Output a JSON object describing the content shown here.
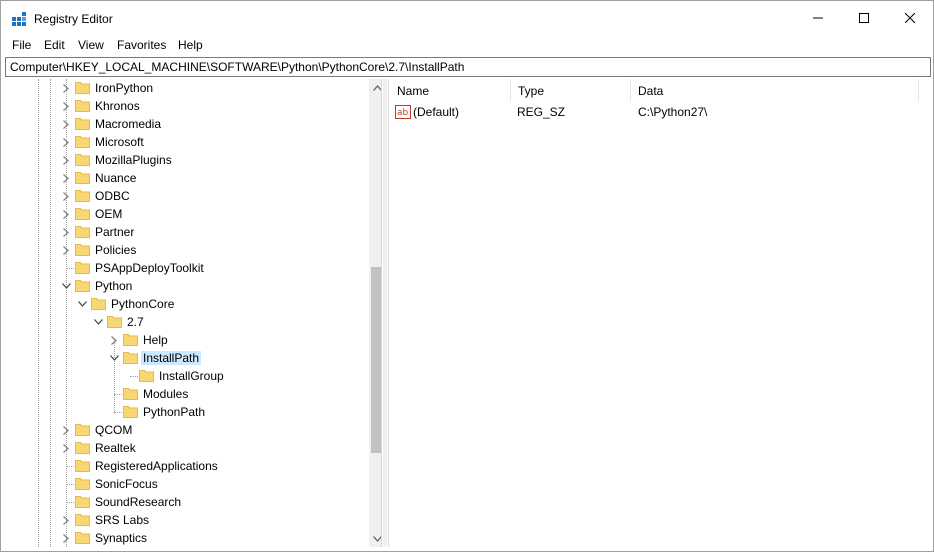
{
  "window": {
    "title": "Registry Editor",
    "icon": "registry-editor-icon",
    "controls": {
      "minimize": "minimize-icon",
      "maximize": "maximize-icon",
      "close": "close-icon"
    }
  },
  "menu": {
    "items": [
      "File",
      "Edit",
      "View",
      "Favorites",
      "Help"
    ]
  },
  "address": {
    "path": "Computer\\HKEY_LOCAL_MACHINE\\SOFTWARE\\Python\\PythonCore\\2.7\\InstallPath"
  },
  "tree": {
    "items": [
      {
        "label": "IronPython",
        "expander": "collapsed"
      },
      {
        "label": "Khronos",
        "expander": "collapsed"
      },
      {
        "label": "Macromedia",
        "expander": "collapsed"
      },
      {
        "label": "Microsoft",
        "expander": "collapsed"
      },
      {
        "label": "MozillaPlugins",
        "expander": "collapsed"
      },
      {
        "label": "Nuance",
        "expander": "collapsed"
      },
      {
        "label": "ODBC",
        "expander": "collapsed"
      },
      {
        "label": "OEM",
        "expander": "collapsed"
      },
      {
        "label": "Partner",
        "expander": "collapsed"
      },
      {
        "label": "Policies",
        "expander": "collapsed"
      },
      {
        "label": "PSAppDeployToolkit",
        "expander": "none"
      },
      {
        "label": "Python",
        "expander": "expanded"
      },
      {
        "label": "PythonCore",
        "expander": "expanded"
      },
      {
        "label": "2.7",
        "expander": "expanded"
      },
      {
        "label": "Help",
        "expander": "collapsed"
      },
      {
        "label": "InstallPath",
        "expander": "expanded",
        "selected": true
      },
      {
        "label": "InstallGroup",
        "expander": "none"
      },
      {
        "label": "Modules",
        "expander": "none"
      },
      {
        "label": "PythonPath",
        "expander": "none"
      },
      {
        "label": "QCOM",
        "expander": "collapsed"
      },
      {
        "label": "Realtek",
        "expander": "collapsed"
      },
      {
        "label": "RegisteredApplications",
        "expander": "none"
      },
      {
        "label": "SonicFocus",
        "expander": "none"
      },
      {
        "label": "SoundResearch",
        "expander": "none"
      },
      {
        "label": "SRS Labs",
        "expander": "collapsed"
      },
      {
        "label": "Synaptics",
        "expander": "collapsed"
      }
    ]
  },
  "list": {
    "columns": [
      "Name",
      "Type",
      "Data"
    ],
    "rows": [
      {
        "name": "(Default)",
        "type": "REG_SZ",
        "data": "C:\\Python27\\",
        "icon": "string-value-icon"
      }
    ]
  },
  "colors": {
    "selection": "#cce8ff",
    "folder": "#f8d775",
    "folder_dark": "#e6b94a"
  }
}
